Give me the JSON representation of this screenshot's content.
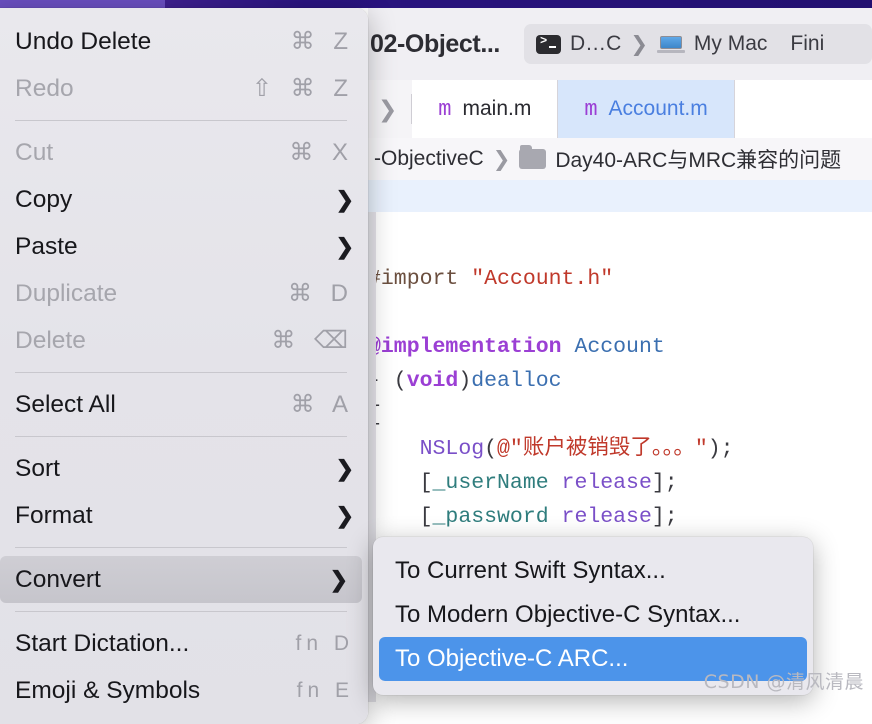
{
  "window": {
    "title": "02-Object...",
    "activity": {
      "scheme_icon": "terminal-icon",
      "scheme": "D…C",
      "separator": "❯",
      "device_icon": "laptop-icon",
      "device": "My Mac",
      "status": "Fini"
    }
  },
  "tabs": {
    "nav_chevron": "❯",
    "items": [
      {
        "icon": "m",
        "label": "main.m",
        "active": false
      },
      {
        "icon": "m",
        "label": "Account.m",
        "active": true
      }
    ]
  },
  "pathbar": {
    "project": "-ObjectiveC",
    "chevron": "❯",
    "folder_icon": "folder-icon",
    "folder": "Day40-ARC与MRC兼容的问题"
  },
  "editor": {
    "lines": [
      [
        {
          "t": "#import ",
          "c": "tk-pre"
        },
        {
          "t": "\"Account.h\"",
          "c": "tk-str"
        }
      ],
      [
        {
          "t": " ",
          "c": "tk-plain"
        }
      ],
      [
        {
          "t": "@implementation",
          "c": "tk-kw"
        },
        {
          "t": " ",
          "c": "tk-plain"
        },
        {
          "t": "Account",
          "c": "tk-type"
        }
      ],
      [
        {
          "t": "- (",
          "c": "tk-plain"
        },
        {
          "t": "void",
          "c": "tk-kw"
        },
        {
          "t": ")",
          "c": "tk-plain"
        },
        {
          "t": "dealloc",
          "c": "tk-fn"
        }
      ],
      [
        {
          "t": "{",
          "c": "tk-plain"
        }
      ],
      [
        {
          "t": "    ",
          "c": "tk-plain"
        },
        {
          "t": "NSLog",
          "c": "tk-call"
        },
        {
          "t": "(",
          "c": "tk-plain"
        },
        {
          "t": "@\"账户被销毁了。。。\"",
          "c": "tk-str"
        },
        {
          "t": ");",
          "c": "tk-plain"
        }
      ],
      [
        {
          "t": "    [",
          "c": "tk-plain"
        },
        {
          "t": "_userName",
          "c": "tk-ident"
        },
        {
          "t": " ",
          "c": "tk-plain"
        },
        {
          "t": "release",
          "c": "tk-meth"
        },
        {
          "t": "];",
          "c": "tk-plain"
        }
      ],
      [
        {
          "t": "    [",
          "c": "tk-plain"
        },
        {
          "t": "_password",
          "c": "tk-ident"
        },
        {
          "t": " ",
          "c": "tk-plain"
        },
        {
          "t": "release",
          "c": "tk-meth"
        },
        {
          "t": "];",
          "c": "tk-plain"
        }
      ]
    ]
  },
  "context_menu": {
    "items": [
      {
        "kind": "item",
        "label": "Undo Delete",
        "shortcut": "⌘ Z",
        "disabled": false,
        "submenu": false,
        "highlight": false
      },
      {
        "kind": "item",
        "label": "Redo",
        "shortcut": "⇧ ⌘ Z",
        "disabled": true,
        "submenu": false,
        "highlight": false
      },
      {
        "kind": "separator"
      },
      {
        "kind": "item",
        "label": "Cut",
        "shortcut": "⌘ X",
        "disabled": true,
        "submenu": false,
        "highlight": false
      },
      {
        "kind": "item",
        "label": "Copy",
        "shortcut": "",
        "disabled": false,
        "submenu": true,
        "highlight": false
      },
      {
        "kind": "item",
        "label": "Paste",
        "shortcut": "",
        "disabled": false,
        "submenu": true,
        "highlight": false
      },
      {
        "kind": "item",
        "label": "Duplicate",
        "shortcut": "⌘ D",
        "disabled": true,
        "submenu": false,
        "highlight": false
      },
      {
        "kind": "item",
        "label": "Delete",
        "shortcut": "⌘ ⌫",
        "disabled": true,
        "submenu": false,
        "highlight": false
      },
      {
        "kind": "separator"
      },
      {
        "kind": "item",
        "label": "Select All",
        "shortcut": "⌘ A",
        "disabled": false,
        "submenu": false,
        "highlight": false
      },
      {
        "kind": "separator"
      },
      {
        "kind": "item",
        "label": "Sort",
        "shortcut": "",
        "disabled": false,
        "submenu": true,
        "highlight": false
      },
      {
        "kind": "item",
        "label": "Format",
        "shortcut": "",
        "disabled": false,
        "submenu": true,
        "highlight": false
      },
      {
        "kind": "separator"
      },
      {
        "kind": "item",
        "label": "Convert",
        "shortcut": "",
        "disabled": false,
        "submenu": true,
        "highlight": true
      },
      {
        "kind": "separator"
      },
      {
        "kind": "item",
        "label": "Start Dictation...",
        "shortcut": "fn D",
        "disabled": false,
        "submenu": false,
        "highlight": false,
        "fnkey": true
      },
      {
        "kind": "item",
        "label": "Emoji & Symbols",
        "shortcut": "fn E",
        "disabled": false,
        "submenu": false,
        "highlight": false,
        "fnkey": true
      }
    ]
  },
  "submenu": {
    "items": [
      {
        "label": "To Current Swift Syntax...",
        "selected": false
      },
      {
        "label": "To Modern Objective-C Syntax...",
        "selected": false
      },
      {
        "label": "To Objective-C ARC...",
        "selected": true
      }
    ]
  },
  "watermark": "CSDN @清风清晨",
  "colors": {
    "menubar_purple": "#2a1480",
    "highlight_blue": "#4c94ea",
    "tab_active_bg": "#d7e6fb",
    "tab_active_text": "#4a7fe0",
    "menu_bg": "#e6e5eb",
    "menu_highlight": "#cbcad1"
  }
}
